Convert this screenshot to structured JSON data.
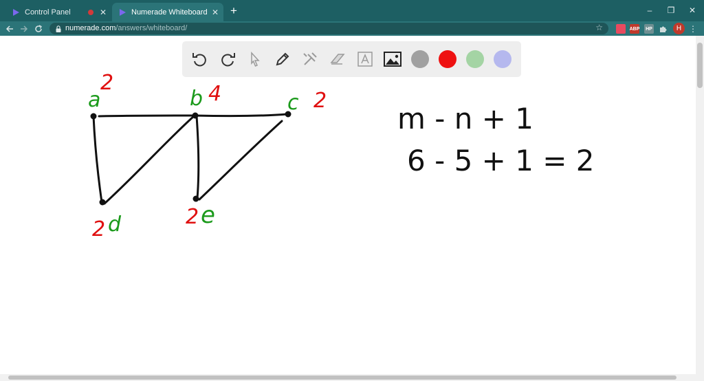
{
  "browser": {
    "tabs": [
      {
        "title": "Control Panel",
        "active": false,
        "recording": true
      },
      {
        "title": "Numerade Whiteboard",
        "active": true
      }
    ],
    "new_tab_label": "+",
    "window_controls": {
      "minimize": "–",
      "maximize": "❐",
      "close": "✕"
    },
    "url": {
      "host": "numerade.com",
      "path": "/answers/whiteboard/"
    },
    "extensions": [
      {
        "icon": "pocket-icon",
        "label": "",
        "color": "#e84a5f"
      },
      {
        "icon": "adblock-icon",
        "label": "ABP",
        "color": "#c0392b"
      },
      {
        "icon": "hp-icon",
        "label": "HP",
        "color": "#6f8f92"
      },
      {
        "icon": "puzzle-icon",
        "label": "",
        "color": "#cfdcdc"
      }
    ],
    "avatar_letter": "H"
  },
  "whiteboard": {
    "tools": [
      "undo-icon",
      "redo-icon",
      "pointer-icon",
      "pen-icon",
      "tools-icon",
      "eraser-icon",
      "text-icon",
      "image-icon"
    ],
    "colors": [
      {
        "name": "gray",
        "hex": "#a0a0a0"
      },
      {
        "name": "red",
        "hex": "#ee1111"
      },
      {
        "name": "green",
        "hex": "#a4d4a4"
      },
      {
        "name": "lavender",
        "hex": "#b5b8ee"
      }
    ],
    "ink": {
      "green": "#1b9a1b",
      "red": "#e01010",
      "black": "#111111"
    },
    "vertices": [
      {
        "name": "a",
        "degree": "2"
      },
      {
        "name": "b",
        "degree": "4"
      },
      {
        "name": "c",
        "degree": "2"
      },
      {
        "name": "d",
        "degree": "2"
      },
      {
        "name": "e",
        "degree": "2"
      }
    ],
    "formula_lines": [
      "m - n + 1",
      "6 - 5 + 1 = 2"
    ]
  }
}
